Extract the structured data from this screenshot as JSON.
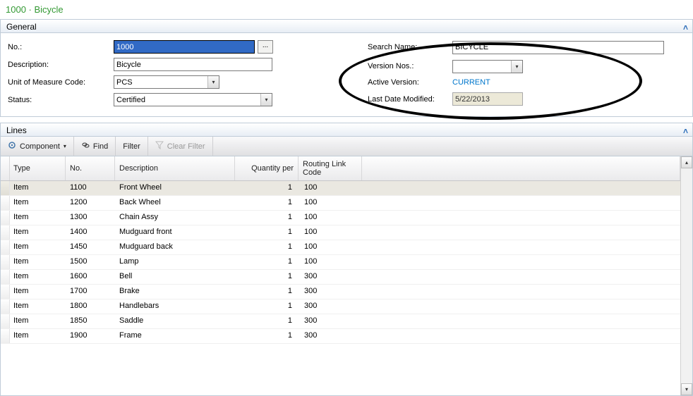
{
  "title": "1000 · Bicycle",
  "panels": {
    "general": "General",
    "lines": "Lines"
  },
  "fields": {
    "no_label": "No.:",
    "no_value": "1000",
    "desc_label": "Description:",
    "desc_value": "Bicycle",
    "uom_label": "Unit of Measure Code:",
    "uom_value": "PCS",
    "status_label": "Status:",
    "status_value": "Certified",
    "search_label": "Search Name:",
    "search_value": "BICYCLE",
    "version_label": "Version Nos.:",
    "version_value": "",
    "active_label": "Active Version:",
    "active_value": "CURRENT",
    "lastmod_label": "Last Date Modified:",
    "lastmod_value": "5/22/2013",
    "ellipsis": "..."
  },
  "toolbar": {
    "component": "Component",
    "find": "Find",
    "filter": "Filter",
    "clear_filter": "Clear Filter"
  },
  "columns": {
    "type": "Type",
    "no": "No.",
    "desc": "Description",
    "qty": "Quantity per",
    "rlc": "Routing Link Code"
  },
  "rows": [
    {
      "type": "Item",
      "no": "1100",
      "desc": "Front Wheel",
      "qty": "1",
      "rlc": "100"
    },
    {
      "type": "Item",
      "no": "1200",
      "desc": "Back Wheel",
      "qty": "1",
      "rlc": "100"
    },
    {
      "type": "Item",
      "no": "1300",
      "desc": "Chain Assy",
      "qty": "1",
      "rlc": "100"
    },
    {
      "type": "Item",
      "no": "1400",
      "desc": "Mudguard front",
      "qty": "1",
      "rlc": "100"
    },
    {
      "type": "Item",
      "no": "1450",
      "desc": "Mudguard back",
      "qty": "1",
      "rlc": "100"
    },
    {
      "type": "Item",
      "no": "1500",
      "desc": "Lamp",
      "qty": "1",
      "rlc": "100"
    },
    {
      "type": "Item",
      "no": "1600",
      "desc": "Bell",
      "qty": "1",
      "rlc": "300"
    },
    {
      "type": "Item",
      "no": "1700",
      "desc": "Brake",
      "qty": "1",
      "rlc": "300"
    },
    {
      "type": "Item",
      "no": "1800",
      "desc": "Handlebars",
      "qty": "1",
      "rlc": "300"
    },
    {
      "type": "Item",
      "no": "1850",
      "desc": "Saddle",
      "qty": "1",
      "rlc": "300"
    },
    {
      "type": "Item",
      "no": "1900",
      "desc": "Frame",
      "qty": "1",
      "rlc": "300"
    }
  ]
}
